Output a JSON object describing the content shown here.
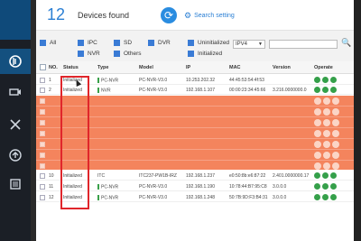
{
  "app": {
    "sidebar_icons": [
      "logo-icon",
      "camera-icon",
      "tools-icon",
      "upload-icon",
      "list-icon"
    ]
  },
  "header": {
    "count": "12",
    "title": "Devices found",
    "search_setting": "Search setting"
  },
  "filters": {
    "items": [
      "All",
      "IPC",
      "SD",
      "DVR",
      "NVR",
      "Others",
      "Uninitialized",
      "Initialized"
    ],
    "ip_version": "IPV4"
  },
  "table": {
    "headers": [
      "NO.",
      "Status",
      "Type",
      "Model",
      "IP",
      "MAC",
      "Version",
      "Operate"
    ],
    "rows_top": [
      {
        "no": "1",
        "status": "Initialized",
        "type": "PC-NVR",
        "model": "PC-NVR-V3.0",
        "ip": "10.253.202.32",
        "mac": "44:45:53:54:4f:53",
        "version": ""
      },
      {
        "no": "2",
        "status": "Initialized",
        "type": "NVR",
        "model": "PC-NVR-V3.0",
        "ip": "192.168.1.107",
        "mac": "00:00:23:34:45:66",
        "version": "3.216.0000000.0"
      }
    ],
    "rows_bottom": [
      {
        "no": "10",
        "status": "Initialized",
        "type": "ITC",
        "model": "ITC237-PW1B-IRZ",
        "ip": "192.168.1.237",
        "mac": "e0:50:8b:e6:87:22",
        "version": "2.401.0000000.17"
      },
      {
        "no": "11",
        "status": "Initialized",
        "type": "PC-NVR",
        "model": "PC-NVR-V3.0",
        "ip": "192.168.1.190",
        "mac": "10:78:44:B7:95:C8",
        "version": "3.0.0.0"
      },
      {
        "no": "12",
        "status": "Initialized",
        "type": "PC-NVR",
        "model": "PC-NVR-V3.0",
        "ip": "192.168.1.248",
        "mac": "50:7B:9D:F3:B4:31",
        "version": "3.0.0.0"
      }
    ]
  }
}
